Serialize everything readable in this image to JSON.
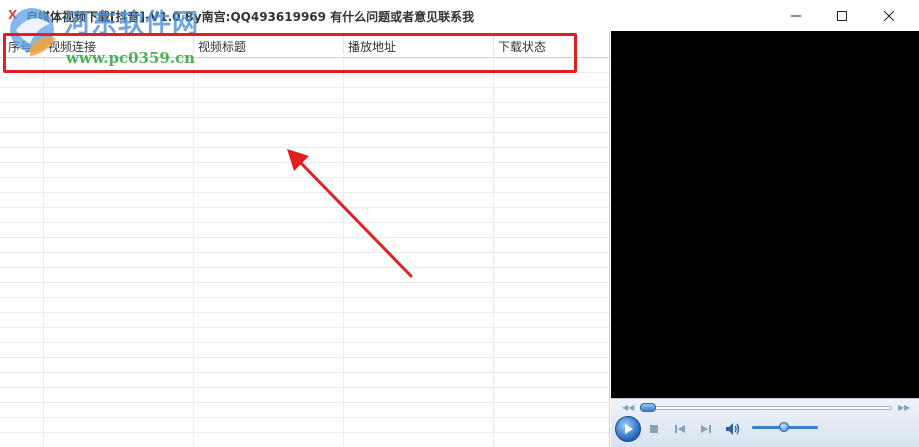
{
  "window": {
    "title": "自媒体视频下载[抖音]-V1.0    By南宫:QQ493619969   有什么问题或者意见联系我",
    "app_icon": "x-app-icon",
    "controls": [
      "minimize-icon",
      "maximize-icon",
      "close-icon"
    ]
  },
  "grid": {
    "columns": [
      "序号",
      "视频连接",
      "视频标题",
      "播放地址",
      "下载状态"
    ],
    "rows": []
  },
  "watermark": {
    "name": "河东软件网",
    "url": "www.pc0359.cn"
  },
  "player": {
    "controls": [
      "play-icon",
      "stop-icon",
      "previous-icon",
      "next-icon",
      "volume-icon"
    ]
  },
  "colors": {
    "highlight": "#e02020",
    "player_background": "#000000",
    "watermark_blue": "#4a8fd6",
    "watermark_green": "#3aa84a"
  }
}
